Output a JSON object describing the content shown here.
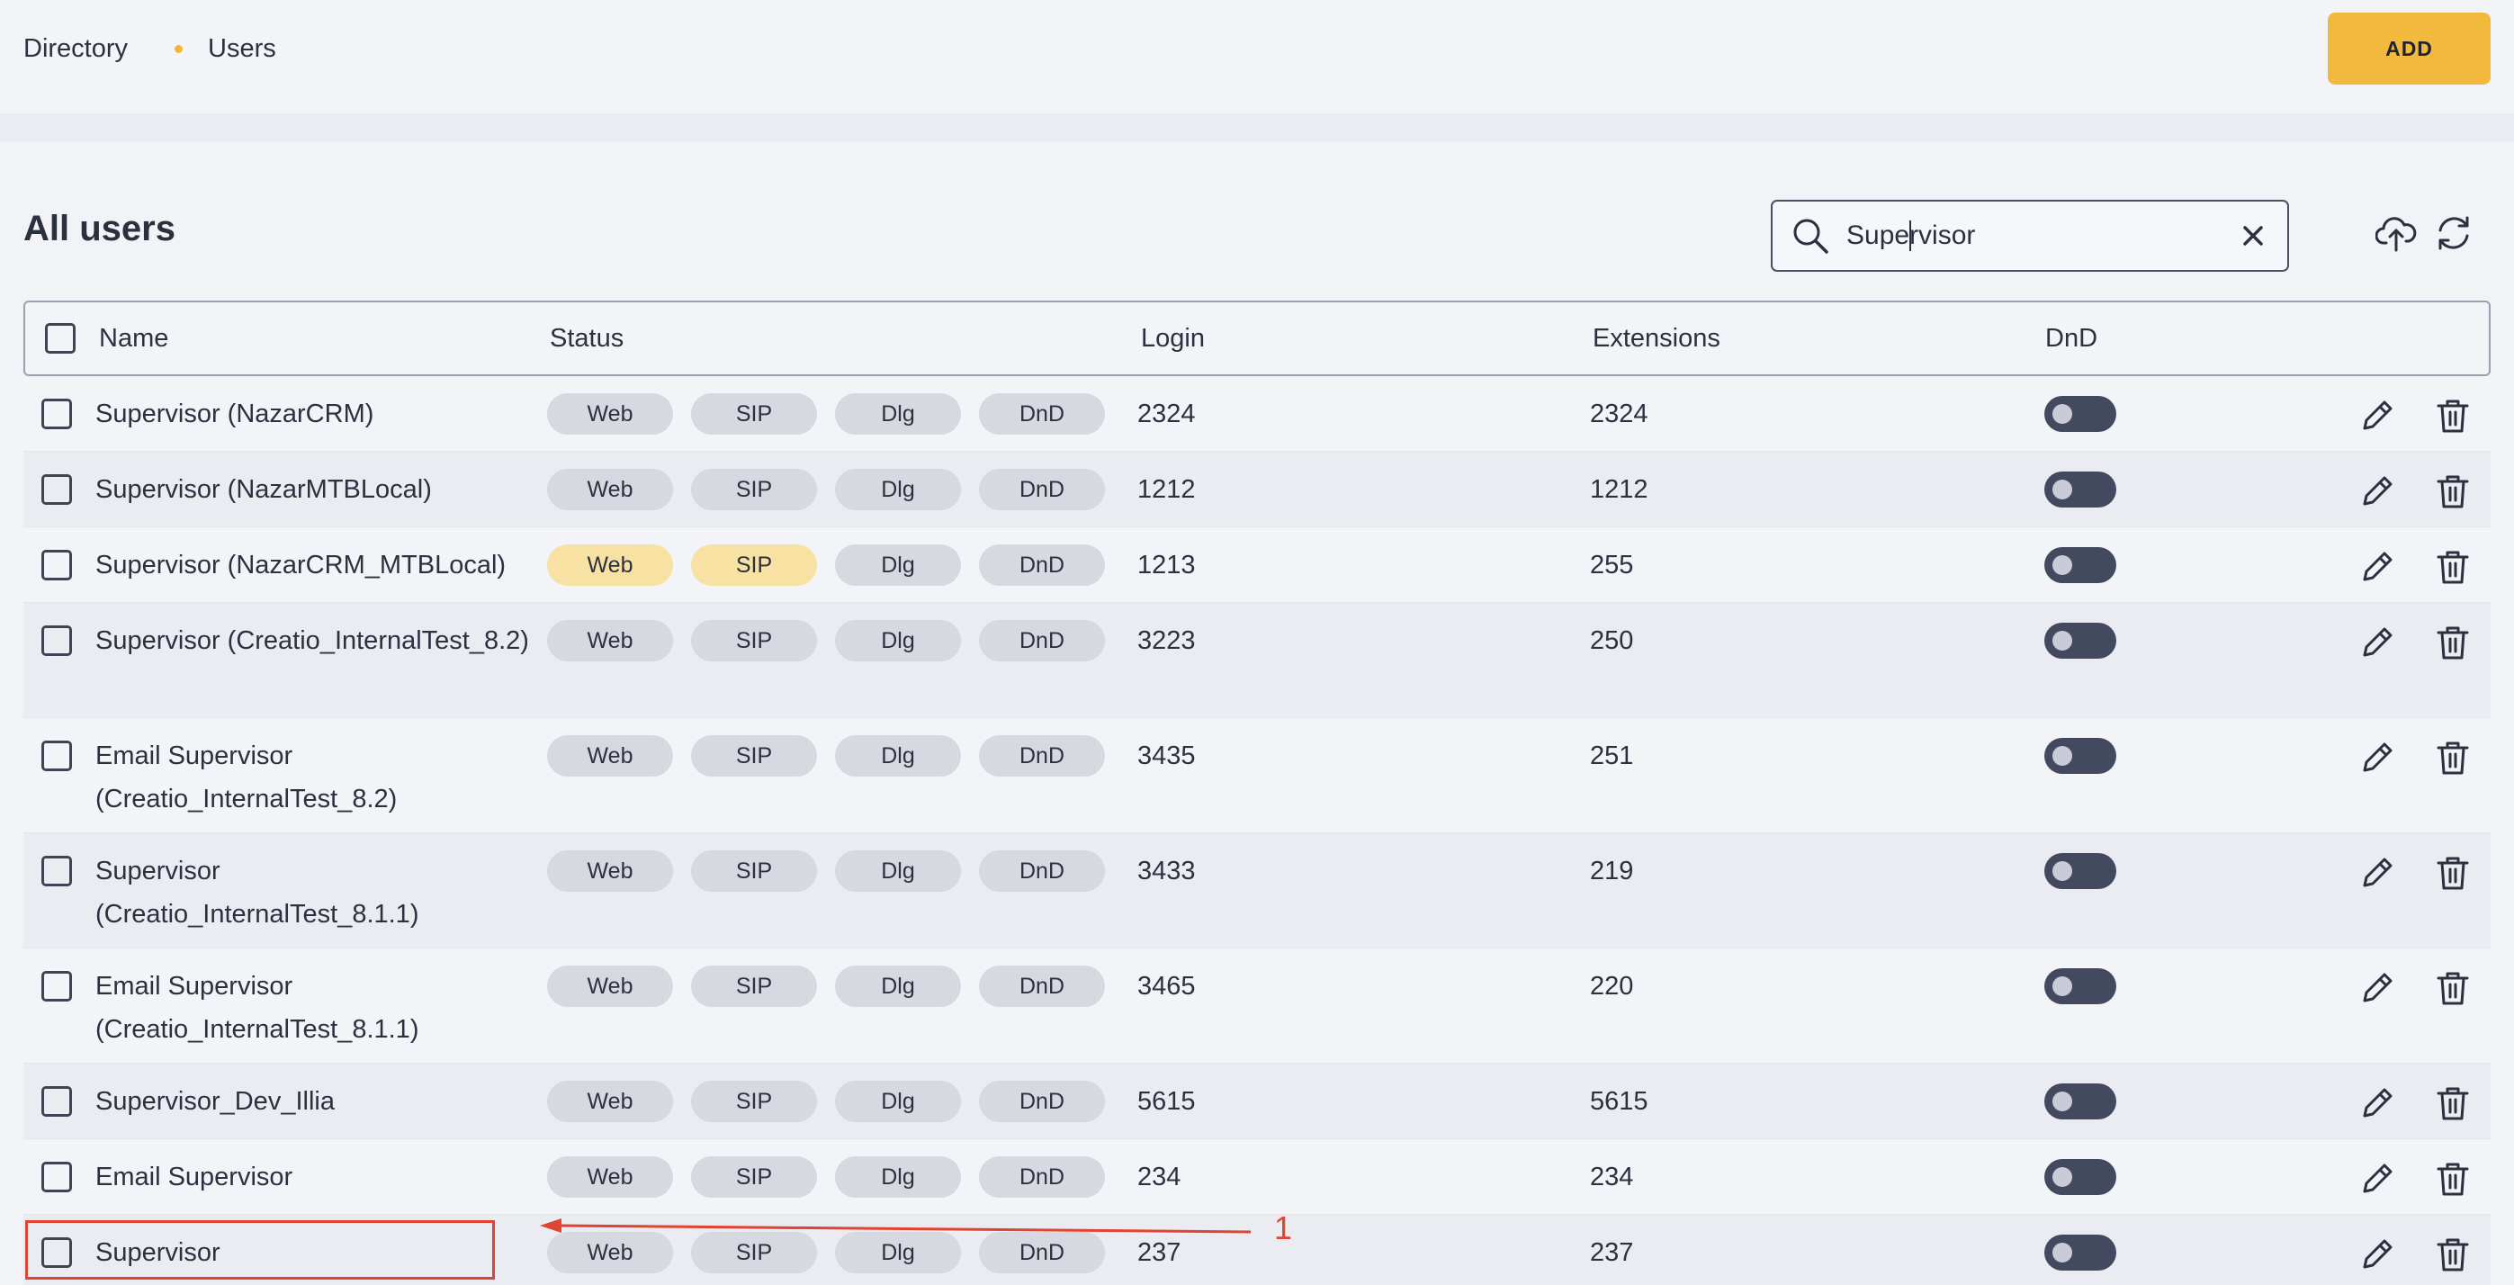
{
  "breadcrumb": {
    "root": "Directory",
    "current": "Users"
  },
  "header": {
    "add_label": "ADD"
  },
  "page": {
    "title": "All users"
  },
  "search": {
    "value": "Supervisor",
    "placeholder": ""
  },
  "table": {
    "columns": {
      "name": "Name",
      "status": "Status",
      "login": "Login",
      "extensions": "Extensions",
      "dnd": "DnD"
    },
    "rows": [
      {
        "name": "Supervisor (NazarCRM)",
        "login": "2324",
        "extensions": "2324",
        "statuses": [
          "Web",
          "SIP",
          "Dlg",
          "DnD"
        ],
        "active": [
          false,
          false,
          false,
          false
        ],
        "dnd": false
      },
      {
        "name": "Supervisor (NazarMTBLocal)",
        "login": "1212",
        "extensions": "1212",
        "statuses": [
          "Web",
          "SIP",
          "Dlg",
          "DnD"
        ],
        "active": [
          false,
          false,
          false,
          false
        ],
        "dnd": false
      },
      {
        "name": "Supervisor (NazarCRM_MTBLocal)",
        "login": "1213",
        "extensions": "255",
        "statuses": [
          "Web",
          "SIP",
          "Dlg",
          "DnD"
        ],
        "active": [
          true,
          true,
          false,
          false
        ],
        "dnd": false
      },
      {
        "name": "Supervisor (Creatio_InternalTest_8.2)",
        "login": "3223",
        "extensions": "250",
        "statuses": [
          "Web",
          "SIP",
          "Dlg",
          "DnD"
        ],
        "active": [
          false,
          false,
          false,
          false
        ],
        "dnd": false
      },
      {
        "name": "Email Supervisor (Creatio_InternalTest_8.2)",
        "login": "3435",
        "extensions": "251",
        "statuses": [
          "Web",
          "SIP",
          "Dlg",
          "DnD"
        ],
        "active": [
          false,
          false,
          false,
          false
        ],
        "dnd": false
      },
      {
        "name": "Supervisor (Creatio_InternalTest_8.1.1)",
        "login": "3433",
        "extensions": "219",
        "statuses": [
          "Web",
          "SIP",
          "Dlg",
          "DnD"
        ],
        "active": [
          false,
          false,
          false,
          false
        ],
        "dnd": false
      },
      {
        "name": "Email Supervisor (Creatio_InternalTest_8.1.1)",
        "login": "3465",
        "extensions": "220",
        "statuses": [
          "Web",
          "SIP",
          "Dlg",
          "DnD"
        ],
        "active": [
          false,
          false,
          false,
          false
        ],
        "dnd": false
      },
      {
        "name": "Supervisor_Dev_Illia",
        "login": "5615",
        "extensions": "5615",
        "statuses": [
          "Web",
          "SIP",
          "Dlg",
          "DnD"
        ],
        "active": [
          false,
          false,
          false,
          false
        ],
        "dnd": false
      },
      {
        "name": "Email Supervisor",
        "login": "234",
        "extensions": "234",
        "statuses": [
          "Web",
          "SIP",
          "Dlg",
          "DnD"
        ],
        "active": [
          false,
          false,
          false,
          false
        ],
        "dnd": false
      },
      {
        "name": "Supervisor",
        "login": "237",
        "extensions": "237",
        "statuses": [
          "Web",
          "SIP",
          "Dlg",
          "DnD"
        ],
        "active": [
          false,
          false,
          false,
          false
        ],
        "dnd": false
      }
    ]
  },
  "annotation": {
    "label": "1",
    "color": "#e04433"
  },
  "colors": {
    "accent": "#f3b93d",
    "pill_active": "#f7e1a3",
    "toggle": "#434a60"
  },
  "icons": [
    "search-icon",
    "clear-icon",
    "upload-icon",
    "refresh-icon",
    "edit-icon",
    "trash-icon"
  ]
}
